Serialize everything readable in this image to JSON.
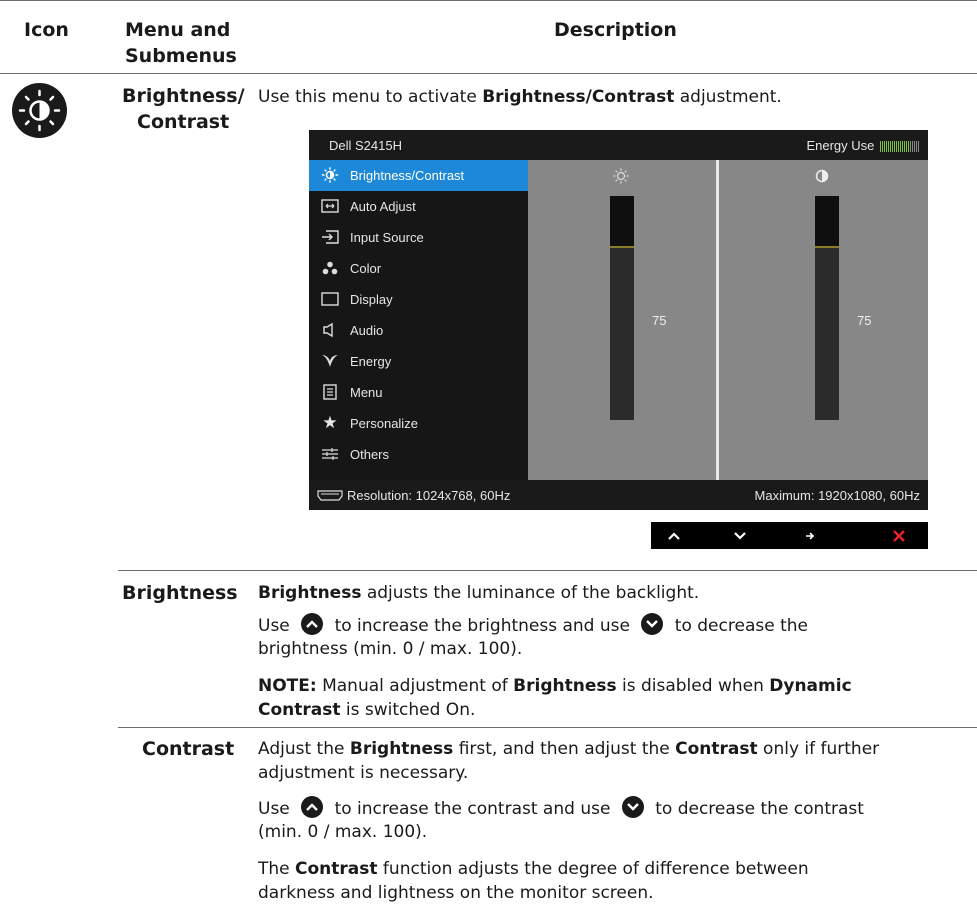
{
  "table_header": {
    "icon": "Icon",
    "menu_line1": "Menu and",
    "menu_line2": "Submenus",
    "description": "Description"
  },
  "icon": "brightness-contrast-icon",
  "main_item": {
    "label_line1": "Brightness/",
    "label_line2": "Contrast",
    "desc_pre": "Use this menu to activate ",
    "desc_bold": "Brightness/Contrast",
    "desc_post": " adjustment."
  },
  "osd": {
    "model": "Dell S2415H",
    "energy_label": "Energy Use",
    "menu_items": [
      {
        "label": "Brightness/Contrast",
        "icon": "sun-icon",
        "selected": true
      },
      {
        "label": "Auto Adjust",
        "icon": "auto-adjust-icon"
      },
      {
        "label": "Input Source",
        "icon": "input-source-icon"
      },
      {
        "label": "Color",
        "icon": "color-icon"
      },
      {
        "label": "Display",
        "icon": "display-icon"
      },
      {
        "label": "Audio",
        "icon": "speaker-icon"
      },
      {
        "label": "Energy",
        "icon": "leaf-icon"
      },
      {
        "label": "Menu",
        "icon": "menu-icon"
      },
      {
        "label": "Personalize",
        "icon": "star-icon"
      },
      {
        "label": "Others",
        "icon": "sliders-icon"
      }
    ],
    "brightness_value": "75",
    "contrast_value": "75",
    "resolution": "Resolution: 1024x768, 60Hz",
    "maximum": "Maximum: 1920x1080, 60Hz",
    "accent_color": "#1e88d8",
    "keys": [
      "up-arrow-icon",
      "down-arrow-icon",
      "right-arrow-icon",
      "close-icon"
    ]
  },
  "brightness": {
    "label": "Brightness",
    "p1_bold": "Brightness",
    "p1_rest": " adjusts the luminance of the backlight.",
    "p2_a": "Use",
    "p2_b": "to increase the brightness and use",
    "p2_c": "to decrease the",
    "p2_d": "brightness (min. 0 / max. 100).",
    "note_bold": "NOTE:",
    "note_a": " Manual adjustment of ",
    "note_b": "Brightness",
    "note_c": " is disabled when ",
    "note_d": "Dynamic",
    "note_e": "Contrast",
    "note_f": " is switched On."
  },
  "contrast": {
    "label": "Contrast",
    "p1_a": "Adjust the ",
    "p1_b": "Brightness",
    "p1_c": " first, and then adjust the ",
    "p1_d": "Contrast",
    "p1_e": " only if further",
    "p1_f": "adjustment is necessary.",
    "p2_a": "Use",
    "p2_b": "to increase the contrast and use",
    "p2_c": "to decrease the contrast",
    "p2_d": "(min. 0 / max. 100).",
    "p3_a": "The ",
    "p3_b": "Contrast",
    "p3_c": " function adjusts the degree of difference between",
    "p3_d": "darkness and lightness on the monitor screen."
  }
}
